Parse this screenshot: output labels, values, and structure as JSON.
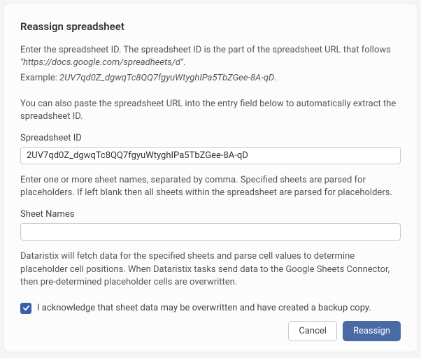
{
  "title": "Reassign spreadsheet",
  "intro": {
    "line1_prefix": "Enter the spreadsheet ID. The spreadsheet ID is the part of the spreadsheet URL that follows ",
    "url_example": "\"https://docs.google.com/spreadheets/d\"",
    "line1_suffix": ".",
    "example_label": "Example: ",
    "example_value": "2UV7qd0Z_dgwqTc8QQ7fgyuWtyghIPa5TbZGee-8A-qD",
    "example_suffix": ".",
    "line2": "You can also paste the spreadsheet URL into the entry field below to automatically extract the spreadsheet ID."
  },
  "spreadsheet_id": {
    "label": "Spreadsheet ID",
    "value": "2UV7qd0Z_dgwqTc8QQ7fgyuWtyghIPa5TbZGee-8A-qD"
  },
  "sheet_names_help": "Enter one or more sheet names, separated by comma. Specified sheets are parsed for placeholders. If left blank then all sheets within the spreadsheet are parsed for placeholders.",
  "sheet_names": {
    "label": "Sheet Names",
    "value": ""
  },
  "fetch_help": "Dataristix will fetch data for the specified sheets and parse cell values to determine placeholder cell positions. When Dataristix tasks send data to the Google Sheets Connector, then pre-determined placeholder cells are overwritten.",
  "ack": {
    "checked": true,
    "label": "I acknowledge that sheet data may be overwritten and have created a backup copy."
  },
  "buttons": {
    "cancel": "Cancel",
    "reassign": "Reassign"
  }
}
